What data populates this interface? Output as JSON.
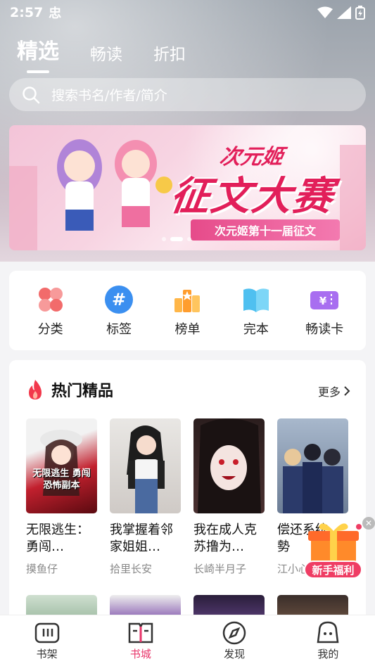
{
  "status_bar": {
    "time": "2:57",
    "app_icon_text": "忠"
  },
  "top_tabs": [
    {
      "label": "精选",
      "active": true
    },
    {
      "label": "畅读",
      "active": false
    },
    {
      "label": "折扣",
      "active": false
    }
  ],
  "search": {
    "placeholder": "搜索书名/作者/简介"
  },
  "banner": {
    "title_top": "次元姬",
    "title_main": "征文大赛",
    "subtitle": "次元姬第十一届征文",
    "page_count": 3,
    "active_page": 1
  },
  "categories": [
    {
      "label": "分类",
      "icon": "category-icon"
    },
    {
      "label": "标签",
      "icon": "tag-icon"
    },
    {
      "label": "榜单",
      "icon": "ranking-icon"
    },
    {
      "label": "完本",
      "icon": "completed-book-icon"
    },
    {
      "label": "畅读卡",
      "icon": "reading-card-icon"
    }
  ],
  "hot_section": {
    "title": "热门精品",
    "more_label": "更多",
    "books": [
      {
        "title": "无限逃生：勇闯…",
        "author": "摸鱼仔",
        "cover_text": "无限逃生 勇闯恐怖副本"
      },
      {
        "title": "我掌握着邻家姐姐…",
        "author": "拾里长安"
      },
      {
        "title": "我在成人克苏撸为…",
        "author": "长崎半月子"
      },
      {
        "title": "偿还系统，勢",
        "author": "江小心"
      }
    ]
  },
  "gift": {
    "label": "新手福利"
  },
  "bottom_nav": [
    {
      "label": "书架",
      "icon": "bookshelf-icon",
      "active": false
    },
    {
      "label": "书城",
      "icon": "bookstore-icon",
      "active": true
    },
    {
      "label": "发现",
      "icon": "compass-icon",
      "active": false
    },
    {
      "label": "我的",
      "icon": "profile-icon",
      "active": false
    }
  ],
  "colors": {
    "accent": "#e8356a",
    "banner_title": "#e21f5a"
  }
}
